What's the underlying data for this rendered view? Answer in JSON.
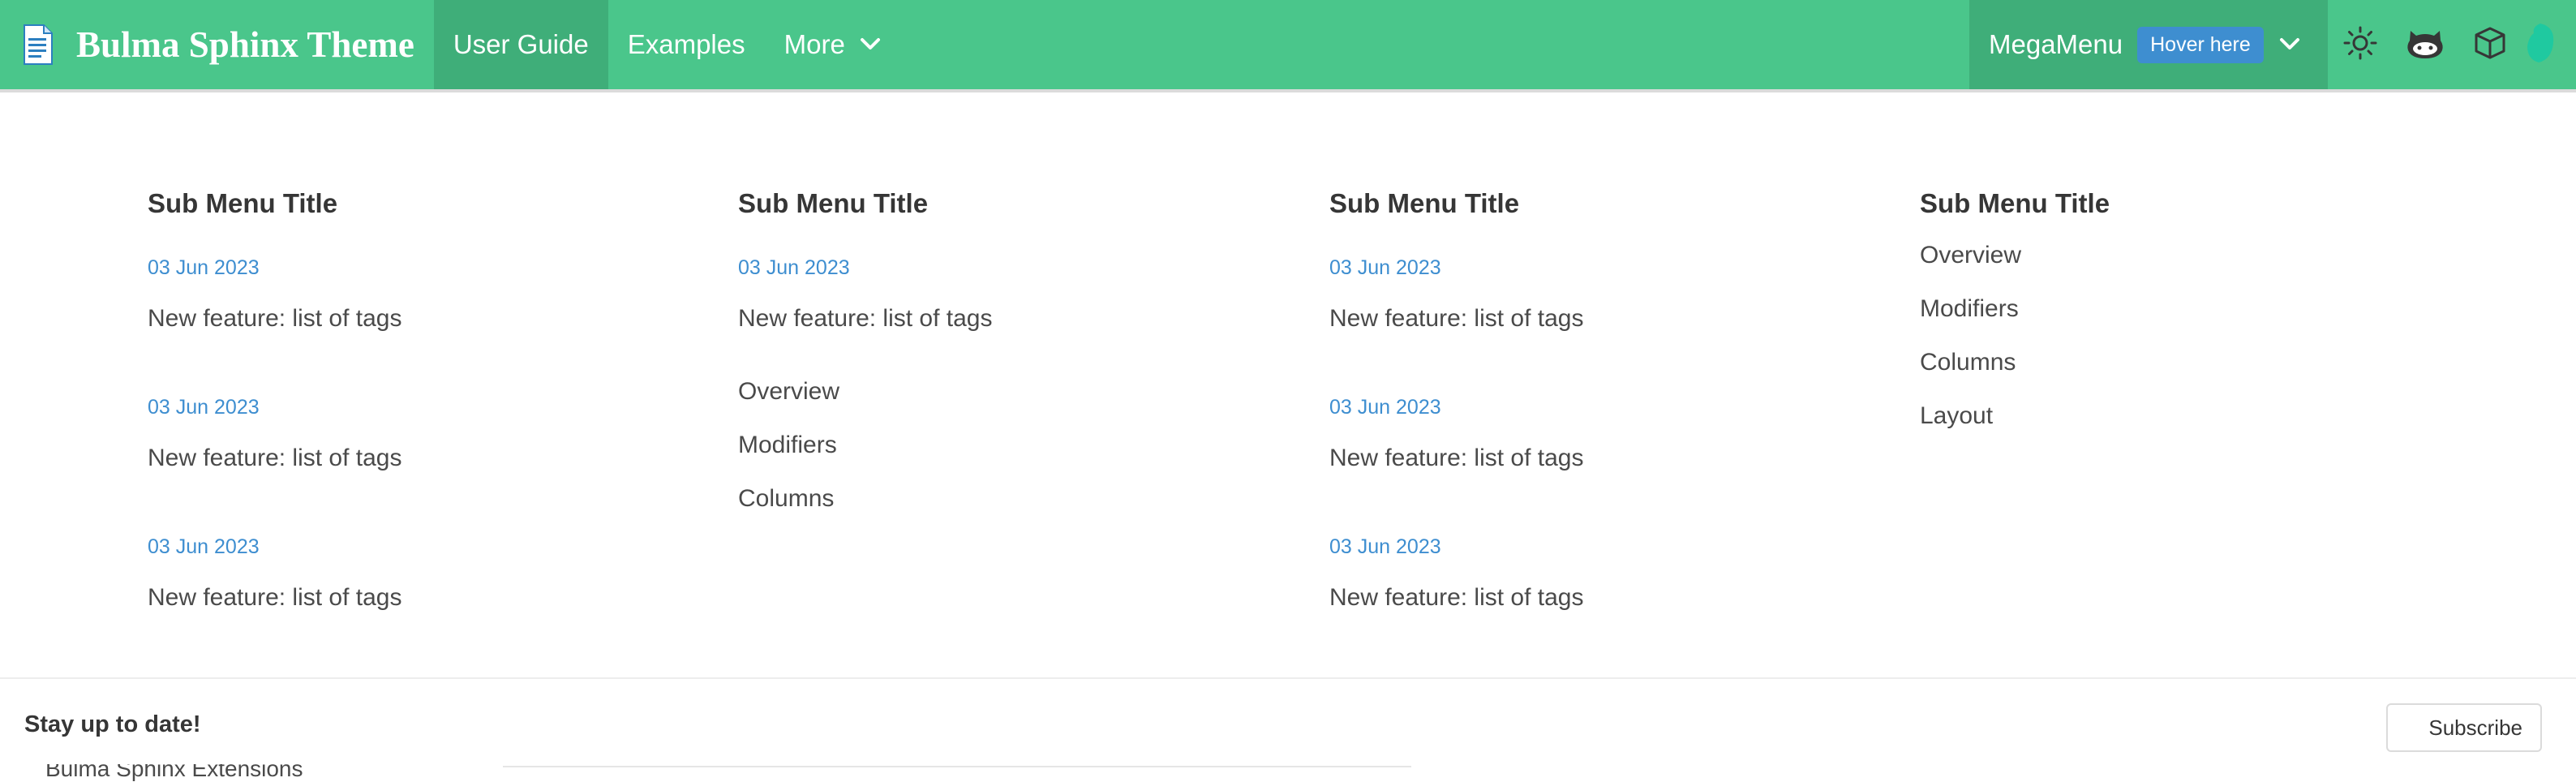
{
  "navbar": {
    "brand": "Bulma Sphinx Theme",
    "items": [
      {
        "label": "User Guide",
        "active": true
      },
      {
        "label": "Examples",
        "active": false
      },
      {
        "label": "More",
        "active": false
      }
    ],
    "megamenu": {
      "label": "MegaMenu",
      "tag": "Hover here"
    },
    "icons": [
      "theme-toggle-sun-icon",
      "github-icon",
      "package-icon",
      "avatar"
    ],
    "colors": {
      "primary": "#4ac68b",
      "active": "#3fae79",
      "link": "#3e8ed0"
    }
  },
  "dropdown": {
    "columns": [
      {
        "title": "Sub Menu Title",
        "entries": [
          {
            "date": "03 Jun 2023",
            "text": "New feature: list of tags"
          },
          {
            "date": "03 Jun 2023",
            "text": "New feature: list of tags"
          },
          {
            "date": "03 Jun 2023",
            "text": "New feature: list of tags"
          }
        ],
        "links": []
      },
      {
        "title": "Sub Menu Title",
        "entries": [
          {
            "date": "03 Jun 2023",
            "text": "New feature: list of tags"
          }
        ],
        "links": [
          "Overview",
          "Modifiers",
          "Columns"
        ]
      },
      {
        "title": "Sub Menu Title",
        "entries": [
          {
            "date": "03 Jun 2023",
            "text": "New feature: list of tags"
          },
          {
            "date": "03 Jun 2023",
            "text": "New feature: list of tags"
          },
          {
            "date": "03 Jun 2023",
            "text": "New feature: list of tags"
          }
        ],
        "links": []
      },
      {
        "title": "Sub Menu Title",
        "entries": [],
        "links": [
          "Overview",
          "Modifiers",
          "Columns",
          "Layout"
        ]
      }
    ]
  },
  "footer": {
    "text": "Stay up to date!",
    "subscribe_label": "Subscribe",
    "underlying_text": "Bulma Sphinx Extensions"
  }
}
